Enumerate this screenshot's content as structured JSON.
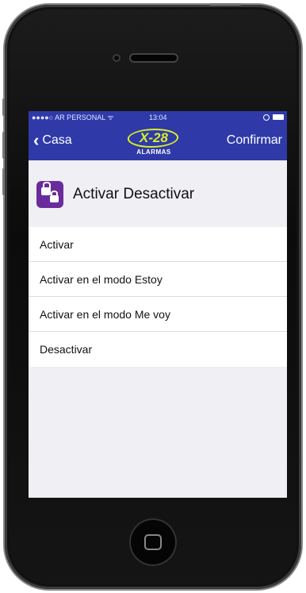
{
  "status_bar": {
    "carrier": "●●●●○ AR PERSONAL ᯤ",
    "time": "13:04"
  },
  "nav": {
    "back_label": "Casa",
    "confirm_label": "Confirmar",
    "logo_text": "X-28",
    "logo_sub": "ALARMAS"
  },
  "header": {
    "title": "Activar Desactivar",
    "icon": "lock-icon"
  },
  "options": [
    {
      "label": "Activar"
    },
    {
      "label": "Activar en el modo Estoy"
    },
    {
      "label": "Activar en el modo Me voy"
    },
    {
      "label": "Desactivar"
    }
  ],
  "colors": {
    "nav_bg": "#2f3aa8",
    "logo": "#d8ef2a",
    "icon_bg": "#6a2c9c",
    "screen_bg": "#efeff4"
  }
}
